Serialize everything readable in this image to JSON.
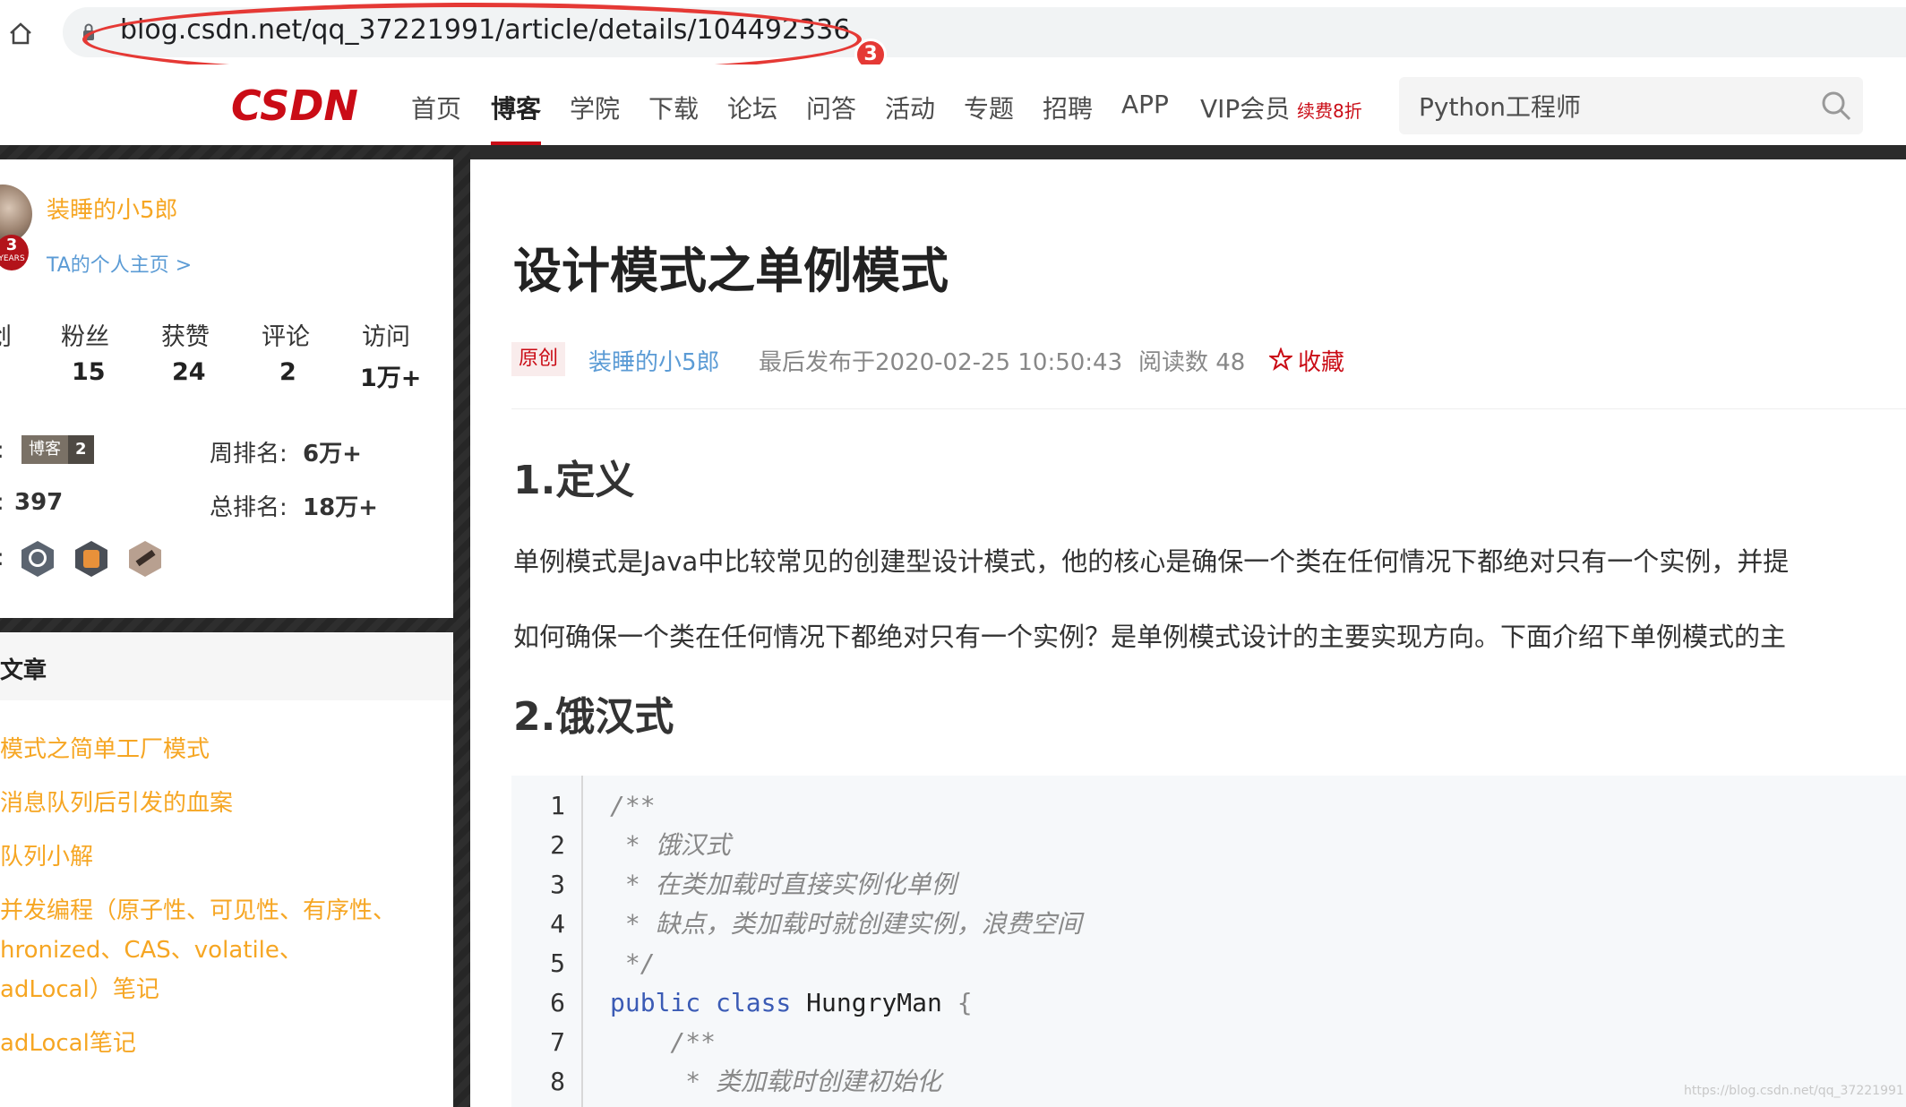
{
  "address_bar": {
    "url": "blog.csdn.net/qq_37221991/article/details/104492336",
    "annotation_number": "3"
  },
  "nav": {
    "logo_text": "CSDN",
    "items": [
      "首页",
      "博客",
      "学院",
      "下载",
      "论坛",
      "问答",
      "活动",
      "专题",
      "招聘",
      "APP",
      "VIP会员"
    ],
    "active": "博客",
    "vip_tag": "续费8折",
    "search_value": "Python工程师"
  },
  "profile": {
    "name": "装睡的小5郎",
    "home_link": "TA的个人主页 >",
    "years": "3",
    "years_label": "YEARS",
    "stats_partial_label": "创",
    "stats": [
      {
        "label": "粉丝",
        "value": "15"
      },
      {
        "label": "获赞",
        "value": "24"
      },
      {
        "label": "评论",
        "value": "2"
      },
      {
        "label": "访问",
        "value": "1万+"
      }
    ],
    "level_prefix": ":",
    "level_badge": "博客",
    "level_num": "2",
    "points_prefix": ":",
    "points": "397",
    "week_rank_label": "周排名:",
    "week_rank": "6万+",
    "total_rank_label": "总排名:",
    "total_rank": "18万+",
    "medals_prefix": ":"
  },
  "recent": {
    "title": "文章",
    "items": [
      "模式之简单工厂模式",
      "消息队列后引发的血案",
      "队列小解",
      "并发编程（原子性、可见性、有序性、",
      "hronized、CAS、volatile、",
      "adLocal）笔记",
      "adLocal笔记"
    ]
  },
  "article": {
    "title": "设计模式之单例模式",
    "tag": "原创",
    "author": "装睡的小5郎",
    "time": "最后发布于2020-02-25 10:50:43",
    "reads": "阅读数 48",
    "favorite": "收藏",
    "h1": "1.定义",
    "p1": "单例模式是Java中比较常见的创建型设计模式，他的核心是确保一个类在任何情况下都绝对只有一个实例，并提",
    "p2": "如何确保一个类在任何情况下都绝对只有一个实例？是单例模式设计的主要实现方向。下面介绍下单例模式的主",
    "h2": "2.饿汉式",
    "code": [
      {
        "n": "1",
        "text": "/**"
      },
      {
        "n": "2",
        "text": " * 饿汉式"
      },
      {
        "n": "3",
        "text": " * 在类加载时直接实例化单例"
      },
      {
        "n": "4",
        "text": " * 缺点，类加载时就创建实例，浪费空间"
      },
      {
        "n": "5",
        "text": " */"
      },
      {
        "n": "6",
        "kw": "public class ",
        "id": "HungryMan",
        "rest": " {"
      },
      {
        "n": "7",
        "text": "    /**"
      },
      {
        "n": "8",
        "text": "     * 类加载时创建初始化"
      }
    ],
    "watermark": "https://blog.csdn.net/qq_37221991"
  },
  "colors": {
    "accent": "#ca0c16",
    "author_orange": "#f6a623",
    "link_blue": "#5b9bd5",
    "annotation_red": "#e53935"
  }
}
